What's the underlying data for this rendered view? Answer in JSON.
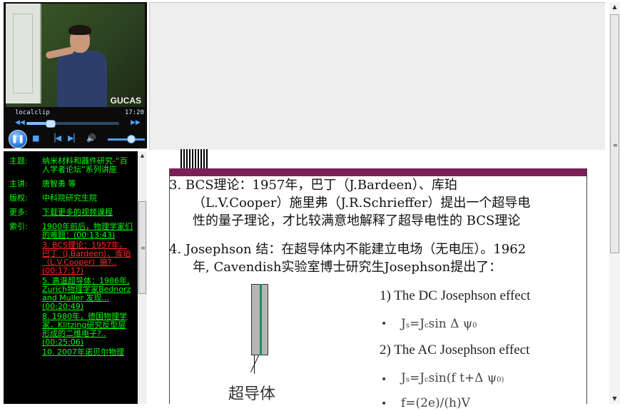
{
  "player": {
    "watermark": "GUCAS",
    "clip_name": "localclip",
    "clip_time": "17:20",
    "progress": 0.25,
    "volume": 0.62,
    "icons": {
      "rewind": "rewind-icon",
      "forward": "fast-forward-icon",
      "pause": "pause-icon",
      "stop": "stop-icon",
      "prev": "previous-icon",
      "next": "next-icon",
      "volume": "volume-icon"
    },
    "glyphs": {
      "rewind": "◀◀",
      "forward": "▶▶",
      "pause": "❚❚",
      "stop": "■",
      "prev": "▕◀",
      "next": "▶▏",
      "volume": "🔊"
    }
  },
  "info": {
    "topic_label": "主题:",
    "topic_value": "纳米材料和器件研究-“百人学者论坛”系列讲座",
    "lecturer_label": "主讲:",
    "lecturer_value": "唐智勇 等",
    "rights_label": "版权:",
    "rights_value": "中科院研究生院",
    "more_label": "更多:",
    "more_link": "下载更多的视频课程",
    "index_label": "索引:",
    "index_items": [
      {
        "text": "1900年前后，物理学家们的难题：(00:13:43)",
        "active": false
      },
      {
        "text": "3. BCS理论：1957年，巴丁（J.Bardeen）、库珀（L.V.Cooper）施?..(00:17:17)",
        "active": true
      },
      {
        "text": "5. 高温超导体：1986年, Zurich物理学家Bednorz and Muller 发现...(00:20:49)",
        "active": false
      },
      {
        "text": "8. 1980年，德国物理学家，Klitzing研究反型层形成的二维电子?..(00:25:06)",
        "active": false
      },
      {
        "text": "10. 2007年诺贝尔物理",
        "active": false
      }
    ]
  },
  "slide": {
    "p3_line1": "3. BCS理论：1957年，巴丁（J.Bardeen）、库珀",
    "p3_line2": "（L.V.Cooper）施里弗（J.R.Schrieffer）提出一个超导电",
    "p3_line3": "性的量子理论，才比较满意地解释了超导电性的 BCS理论",
    "p4_line1": "4. Josephson 结：在超导体内不能建立电场（无电压）。1962",
    "p4_line2": "年, Cavendish实验室博士研究生Josephson提出了：",
    "item1": "1)  The DC Josephson effect",
    "f1_main": "J",
    "f1_sub": "s",
    "f1_rest": "=J",
    "f1_sub2": "c",
    "f1_tail": "sin Δ ψ",
    "f1_sub3": "0",
    "item2": "2)  The AC Josephson effect",
    "f2_main": "J",
    "f2_sub": "s",
    "f2_rest": "=J",
    "f2_sub2": "c",
    "f2_tail": "sin(f  t+Δ ψ",
    "f2_sub3": "0)",
    "f3": "f=(2e)/(h)V",
    "bullet": "•",
    "sc_label": "超导体",
    "accent_color": "#7b2056",
    "wire_stripe_color": "#1a8f5a"
  }
}
